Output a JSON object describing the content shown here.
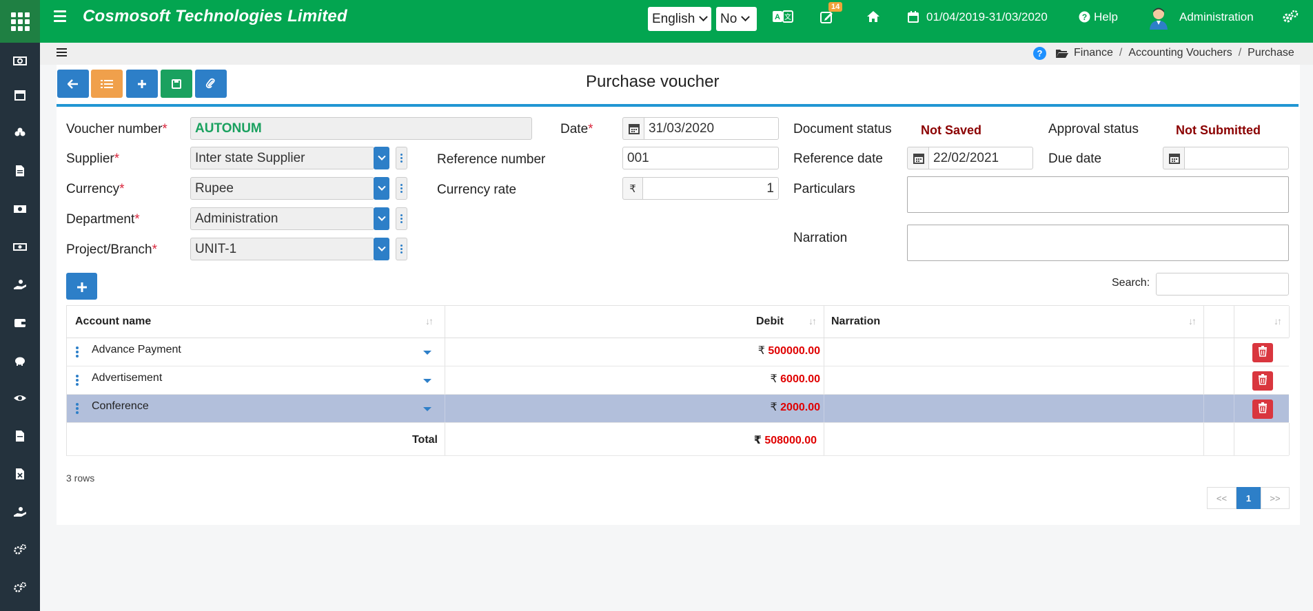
{
  "header": {
    "company": "Cosmosoft Technologies Limited",
    "language": "English",
    "option_select": "No",
    "notification_count": "14",
    "fiscal_period": "01/04/2019-31/03/2020",
    "help": "Help",
    "user": "Administration"
  },
  "breadcrumb": [
    "Finance",
    "Accounting Vouchers",
    "Purchase"
  ],
  "page_title": "Purchase voucher",
  "form": {
    "voucher_number_label": "Voucher number",
    "voucher_number": "AUTONUM",
    "date_label": "Date",
    "date": "31/03/2020",
    "document_status_label": "Document status",
    "document_status": "Not Saved",
    "approval_status_label": "Approval status",
    "approval_status": "Not Submitted",
    "supplier_label": "Supplier",
    "supplier": "Inter state Supplier",
    "reference_number_label": "Reference number",
    "reference_number": "001",
    "reference_date_label": "Reference date",
    "reference_date": "22/02/2021",
    "due_date_label": "Due date",
    "due_date": "",
    "currency_label": "Currency",
    "currency": "Rupee",
    "currency_rate_label": "Currency rate",
    "currency_symbol": "₹",
    "currency_rate": "1",
    "particulars_label": "Particulars",
    "department_label": "Department",
    "department": "Administration",
    "narration_label": "Narration",
    "project_label": "Project/Branch",
    "project": "UNIT-1"
  },
  "table": {
    "search_label": "Search:",
    "columns": [
      "Account name",
      "Debit",
      "Narration"
    ],
    "rows": [
      {
        "account": "Advance Payment",
        "symbol": "₹",
        "debit": "500000.00",
        "narration": ""
      },
      {
        "account": "Advertisement",
        "symbol": "₹",
        "debit": "6000.00",
        "narration": ""
      },
      {
        "account": "Conference",
        "symbol": "₹",
        "debit": "2000.00",
        "narration": ""
      }
    ],
    "total_label": "Total",
    "total_symbol": "₹",
    "total": "508000.00",
    "row_count": "3 rows",
    "pager": {
      "prev": "<<",
      "current": "1",
      "next": ">>"
    }
  },
  "colors": {
    "topbar": "#03a550",
    "sidebar": "#24323d",
    "primary": "#2d7fc8",
    "danger": "#d9363e",
    "status": "#8b0000",
    "selected_row": "#b2bfdb"
  }
}
